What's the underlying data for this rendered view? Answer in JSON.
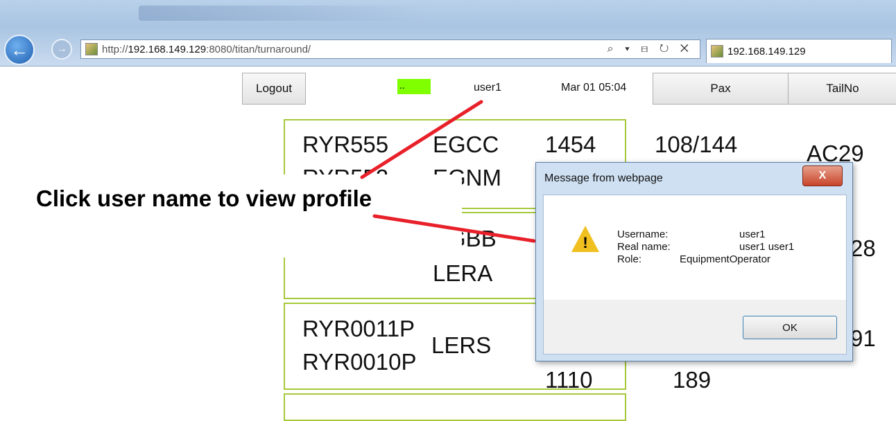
{
  "browser": {
    "url_prefix": "http://",
    "url_host": "192.168.149.129",
    "url_rest": ":8080/titan/turnaround/",
    "tab_title": "192.168.149.129",
    "addr_tools": "⌕ ▾ ⊟ ↻ ✕"
  },
  "header": {
    "logout_label": "Logout",
    "status_text": "..",
    "username": "user1",
    "datetime": "Mar 01 05:04",
    "pax_label": "Pax",
    "tailno_label": "TailNo"
  },
  "cards": [
    {
      "flight1": "RYR555",
      "flight2": "RYR552",
      "airport1": "EGCC",
      "airport2": "EGNM",
      "time1": "1454",
      "pax": "108/144",
      "tail": "AC29"
    },
    {
      "airport1": "EGBB",
      "airport2": "LERA",
      "tail": "28"
    },
    {
      "flight1": "RYR0011P",
      "flight2": "RYR0010P",
      "airport": "LERS",
      "time2": "1110",
      "pax": "189",
      "tail": "91"
    }
  ],
  "annotation": {
    "text": "Click user name to view profile",
    "color": "#e8202a"
  },
  "dialog": {
    "title": "Message from webpage",
    "close_label": "X",
    "username_label": "Username:",
    "username_value": "user1",
    "realname_label": "Real name:",
    "realname_value": "user1 user1",
    "role_label": "Role:",
    "role_value": "EquipmentOperator",
    "ok_label": "OK"
  }
}
